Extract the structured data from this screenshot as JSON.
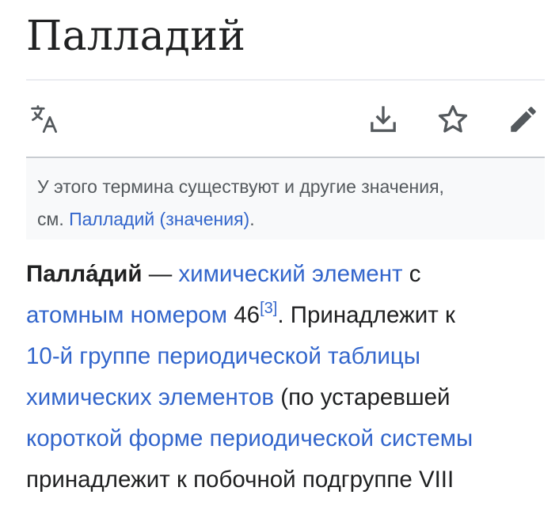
{
  "page": {
    "title": "Палладий"
  },
  "toolbar": {
    "language_icon": "translate-icon",
    "download_icon": "download-icon",
    "watch_icon": "star-icon",
    "edit_icon": "pencil-icon",
    "icon_color": "#54595d"
  },
  "hatnote": {
    "text_before": "У этого термина существуют и другие значения,",
    "text_see": "см. ",
    "link": "Палладий (значения)",
    "text_after": "."
  },
  "article": {
    "line1": {
      "term": "Палла́дий",
      "dash": " — ",
      "link_chemical_element": "химический элемент",
      "text_with": " с"
    },
    "line2": {
      "link_atomic_number": "атомным номером",
      "number": " 46",
      "ref": "[3]",
      "text_belongs": ". Принадлежит к"
    },
    "line3": {
      "link_group": "10-й группе периодической таблицы"
    },
    "line4": {
      "link_group_cont": "химических элементов",
      "text_old": " (по устаревшей"
    },
    "line5": {
      "link_short_form": "короткой форме периодической системы"
    },
    "line6": {
      "text_subgroup": "принадлежит к побочной подгруппе VIII"
    }
  },
  "colors": {
    "link": "#3366cc",
    "text": "#202122",
    "hatnote_bg": "#f8f9fa",
    "hatnote_text": "#54595d"
  }
}
